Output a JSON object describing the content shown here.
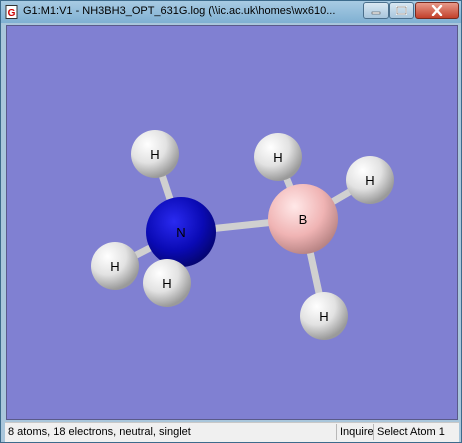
{
  "window": {
    "title": "G1:M1:V1 - NH3BH3_OPT_631G.log (\\\\ic.ac.uk\\homes\\wx610..."
  },
  "molecule": {
    "atoms": [
      {
        "label": "H",
        "element": "hydrogen"
      },
      {
        "label": "H",
        "element": "hydrogen"
      },
      {
        "label": "H",
        "element": "hydrogen"
      },
      {
        "label": "N",
        "element": "nitrogen"
      },
      {
        "label": "H",
        "element": "hydrogen"
      },
      {
        "label": "B",
        "element": "boron"
      },
      {
        "label": "H",
        "element": "hydrogen"
      },
      {
        "label": "H",
        "element": "hydrogen"
      }
    ],
    "colors": {
      "background": "#8080d2",
      "nitrogen": "#0a0ab4",
      "boron": "#f0b4b4",
      "hydrogen": "#e6e6e6",
      "bond": "#d0d0d0"
    }
  },
  "status": {
    "summary": "8 atoms, 18 electrons, neutral, singlet",
    "inquire": "Inquire",
    "select": "Select Atom 1"
  }
}
